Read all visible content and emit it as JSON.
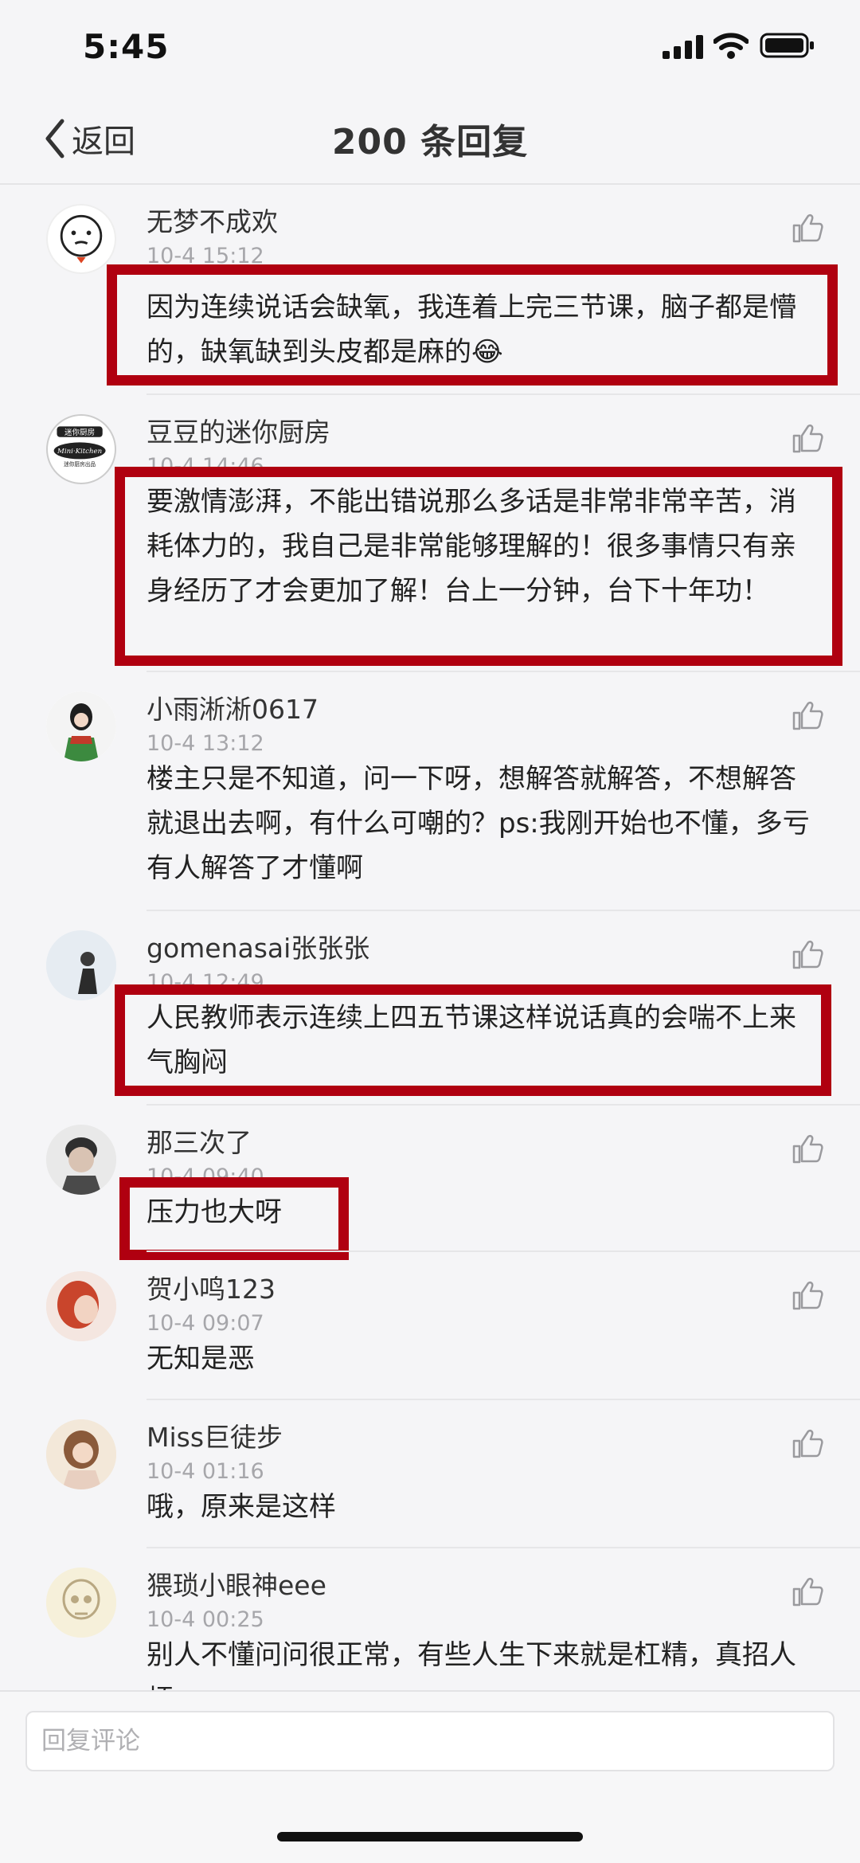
{
  "status_bar": {
    "time": "5:45"
  },
  "nav": {
    "back_label": "返回",
    "title": "200 条回复"
  },
  "comments": [
    {
      "username": "无梦不成欢",
      "time": "10-4 15:12",
      "text": "因为连续说话会缺氧，我连着上完三节课，脑子都是懵的，缺氧缺到头皮都是麻的😂"
    },
    {
      "username": "豆豆的迷你厨房",
      "time": "10-4 14:46",
      "text": "要激情澎湃，不能出错说那么多话是非常非常辛苦，消耗体力的，我自己是非常能够理解的！很多事情只有亲身经历了才会更加了解！台上一分钟，台下十年功！"
    },
    {
      "username": "小雨淅淅0617",
      "time": "10-4 13:12",
      "text": "楼主只是不知道，问一下呀，想解答就解答，不想解答就退出去啊，有什么可嘲的？ps:我刚开始也不懂，多亏有人解答了才懂啊"
    },
    {
      "username": "gomenasai张张张",
      "time": "10-4 12:49",
      "text": "人民教师表示连续上四五节课这样说话真的会喘不上来气胸闷"
    },
    {
      "username": "那三次了",
      "time": "10-4 09:40",
      "text": "压力也大呀"
    },
    {
      "username": "贺小鸣123",
      "time": "10-4 09:07",
      "text": "无知是恶"
    },
    {
      "username": "Miss巨徒步",
      "time": "10-4 01:16",
      "text": "哦，原来是这样"
    },
    {
      "username": "猥琐小眼神eee",
      "time": "10-4 00:25",
      "text": "别人不懂问问很正常，有些人生下来就是杠精，真招人烦"
    }
  ],
  "avatar_badge": {
    "top": "迷你厨房",
    "script": "Mini·Kitchen",
    "bottom": "迷你厨房出品"
  },
  "reply": {
    "placeholder": "回复评论"
  },
  "colors": {
    "highlight": "#b00010",
    "background": "#f5f5f7"
  }
}
